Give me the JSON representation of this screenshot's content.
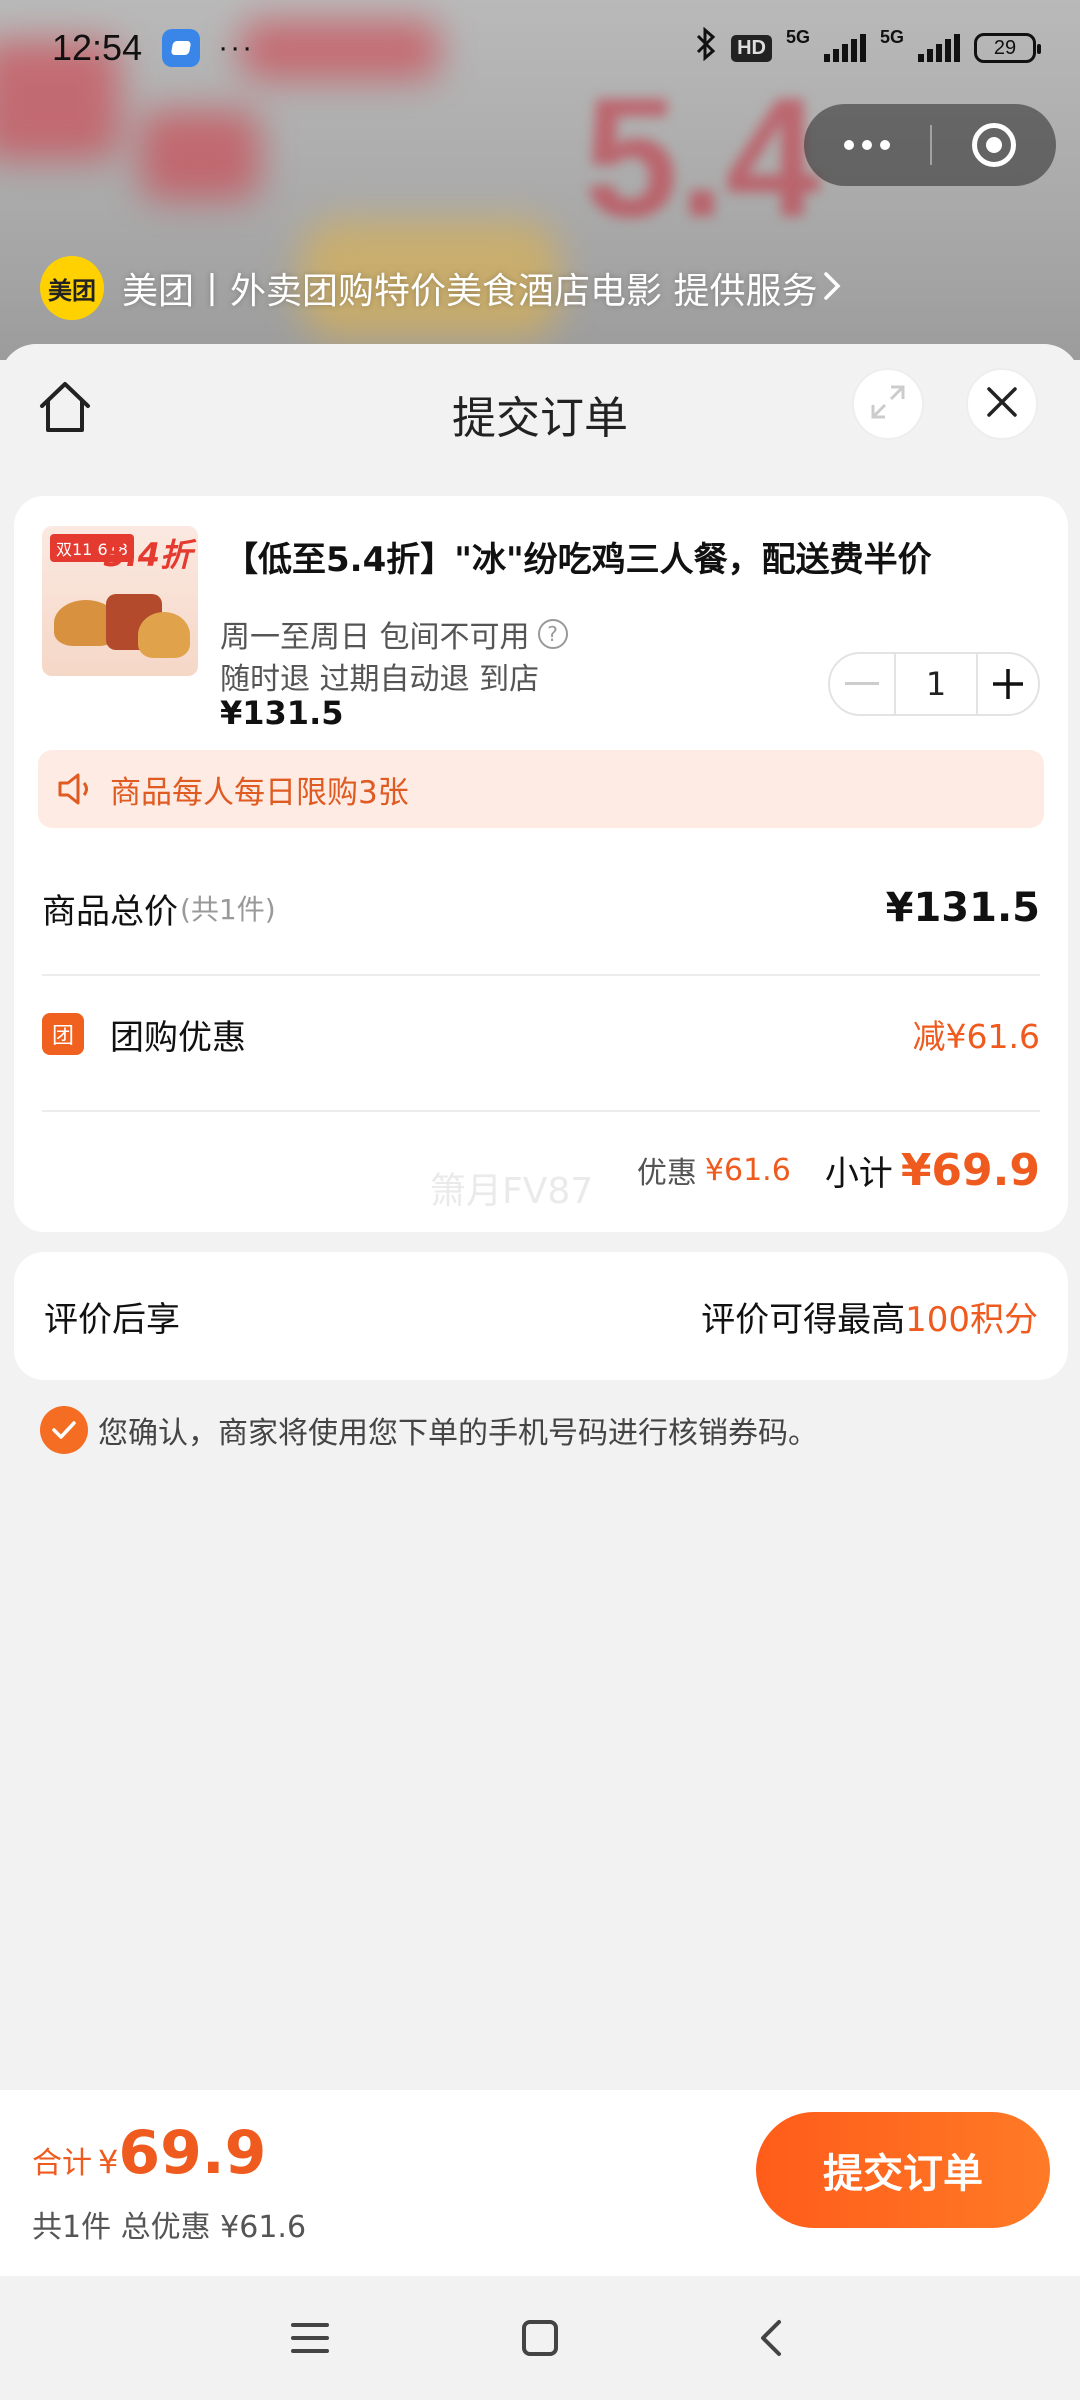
{
  "status_bar": {
    "time": "12:54",
    "dots": "···",
    "hd_label": "HD",
    "net1": "5G",
    "net2": "5G",
    "battery": "29"
  },
  "banner": {
    "big_text": "5.4",
    "provider_logo": "美团",
    "provider_text": "美团丨外卖团购特价美食酒店电影 提供服务",
    "chevron": ">"
  },
  "header": {
    "title": "提交订单",
    "icons": {
      "home": "home-icon",
      "expand": "expand-icon",
      "close": "close-icon"
    }
  },
  "order": {
    "image": {
      "tag": "双11 618",
      "big": "5.4折"
    },
    "title": "【低至5.4折】\"冰\"纷吃鸡三人餐，配送费半价",
    "availability": "周一至周日 包间不可用",
    "availability_help": "?",
    "refund": "随时退 过期自动退 到店",
    "price": "¥131.5",
    "quantity": "1",
    "notice": "商品每人每日限购3张",
    "total_label": "商品总价",
    "total_count": "(共1件)",
    "total_value": "¥131.5",
    "discount_icon": "团",
    "discount_label": "团购优惠",
    "discount_value": "减¥61.6",
    "watermark": "箫月FV87",
    "subtotal_discount_label": "优惠",
    "subtotal_discount_value": "¥61.6",
    "subtotal_label": "小计",
    "subtotal_value": "¥69.9"
  },
  "review": {
    "label": "评价后享",
    "right_prefix": "评价可得最高",
    "right_highlight": "100积分"
  },
  "confirm_text": "您确认，商家将使用您下单的手机号码进行核销券码。",
  "bottom": {
    "total_label": "合计",
    "currency": "¥",
    "total_amount": "69.9",
    "summary": "共1件 总优惠 ¥61.6",
    "submit_label": "提交订单"
  },
  "colors": {
    "accent": "#ef5a1e",
    "button": "#ff6a20",
    "notice_bg": "#fdebe4",
    "meituan_yellow": "#ffd100"
  }
}
